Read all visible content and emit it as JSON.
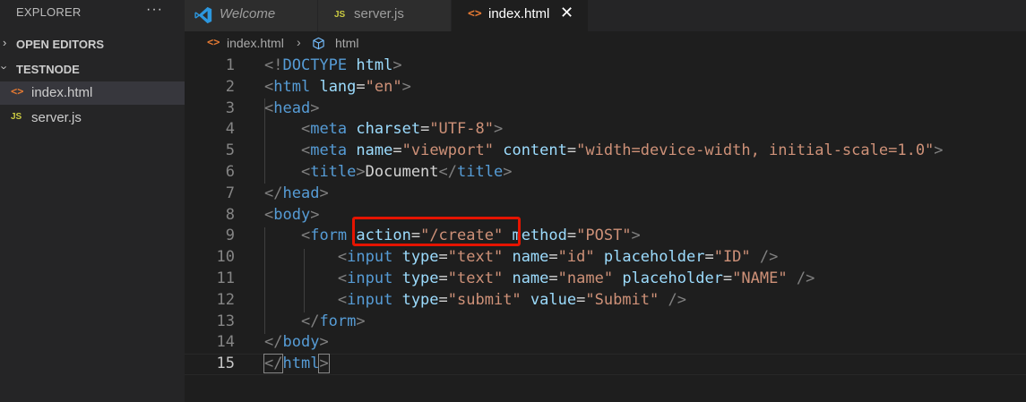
{
  "sidebar": {
    "title": "EXPLORER",
    "more": "···",
    "sections": [
      {
        "label": "OPEN EDITORS"
      },
      {
        "label": "TESTNODE"
      }
    ],
    "files": [
      {
        "name": "index.html",
        "icon": "<>",
        "type": "html"
      },
      {
        "name": "server.js",
        "icon": "JS",
        "type": "js"
      }
    ]
  },
  "tabs": [
    {
      "label": "Welcome"
    },
    {
      "label": "server.js",
      "icon": "JS"
    },
    {
      "label": "index.html",
      "icon": "<>",
      "close": "✕"
    }
  ],
  "breadcrumb": {
    "file": "index.html",
    "icon": "<>",
    "separator": "›",
    "element": "html"
  },
  "editor": {
    "active_line": 15,
    "lines": [
      {
        "n": "1",
        "tokens": [
          [
            "p",
            "<!"
          ],
          [
            "t",
            "DOCTYPE"
          ],
          [
            "x",
            " "
          ],
          [
            "a",
            "html"
          ],
          [
            "p",
            ">"
          ]
        ]
      },
      {
        "n": "2",
        "tokens": [
          [
            "p",
            "<"
          ],
          [
            "t",
            "html"
          ],
          [
            "x",
            " "
          ],
          [
            "a",
            "lang"
          ],
          [
            "x",
            "="
          ],
          [
            "s",
            "\"en\""
          ],
          [
            "p",
            ">"
          ]
        ]
      },
      {
        "n": "3",
        "tokens": [
          [
            "p",
            "<"
          ],
          [
            "t",
            "head"
          ],
          [
            "p",
            ">"
          ]
        ]
      },
      {
        "n": "4",
        "tokens": [
          [
            "x",
            "    "
          ],
          [
            "p",
            "<"
          ],
          [
            "t",
            "meta"
          ],
          [
            "x",
            " "
          ],
          [
            "a",
            "charset"
          ],
          [
            "x",
            "="
          ],
          [
            "s",
            "\"UTF-8\""
          ],
          [
            "p",
            ">"
          ]
        ]
      },
      {
        "n": "5",
        "tokens": [
          [
            "x",
            "    "
          ],
          [
            "p",
            "<"
          ],
          [
            "t",
            "meta"
          ],
          [
            "x",
            " "
          ],
          [
            "a",
            "name"
          ],
          [
            "x",
            "="
          ],
          [
            "s",
            "\"viewport\""
          ],
          [
            "x",
            " "
          ],
          [
            "a",
            "content"
          ],
          [
            "x",
            "="
          ],
          [
            "s",
            "\"width=device-width, initial-scale=1.0\""
          ],
          [
            "p",
            ">"
          ]
        ]
      },
      {
        "n": "6",
        "tokens": [
          [
            "x",
            "    "
          ],
          [
            "p",
            "<"
          ],
          [
            "t",
            "title"
          ],
          [
            "p",
            ">"
          ],
          [
            "x",
            "Document"
          ],
          [
            "p",
            "</"
          ],
          [
            "t",
            "title"
          ],
          [
            "p",
            ">"
          ]
        ]
      },
      {
        "n": "7",
        "tokens": [
          [
            "p",
            "</"
          ],
          [
            "t",
            "head"
          ],
          [
            "p",
            ">"
          ]
        ]
      },
      {
        "n": "8",
        "tokens": [
          [
            "p",
            "<"
          ],
          [
            "t",
            "body"
          ],
          [
            "p",
            ">"
          ]
        ]
      },
      {
        "n": "9",
        "tokens": [
          [
            "x",
            "    "
          ],
          [
            "p",
            "<"
          ],
          [
            "t",
            "form"
          ],
          [
            "x",
            " "
          ],
          [
            "a",
            "action"
          ],
          [
            "x",
            "="
          ],
          [
            "s",
            "\"/create\""
          ],
          [
            "x",
            " "
          ],
          [
            "a",
            "method"
          ],
          [
            "x",
            "="
          ],
          [
            "s",
            "\"POST\""
          ],
          [
            "p",
            ">"
          ]
        ]
      },
      {
        "n": "10",
        "tokens": [
          [
            "x",
            "        "
          ],
          [
            "p",
            "<"
          ],
          [
            "t",
            "input"
          ],
          [
            "x",
            " "
          ],
          [
            "a",
            "type"
          ],
          [
            "x",
            "="
          ],
          [
            "s",
            "\"text\""
          ],
          [
            "x",
            " "
          ],
          [
            "a",
            "name"
          ],
          [
            "x",
            "="
          ],
          [
            "s",
            "\"id\""
          ],
          [
            "x",
            " "
          ],
          [
            "a",
            "placeholder"
          ],
          [
            "x",
            "="
          ],
          [
            "s",
            "\"ID\""
          ],
          [
            "x",
            " "
          ],
          [
            "p",
            "/>"
          ]
        ]
      },
      {
        "n": "11",
        "tokens": [
          [
            "x",
            "        "
          ],
          [
            "p",
            "<"
          ],
          [
            "t",
            "input"
          ],
          [
            "x",
            " "
          ],
          [
            "a",
            "type"
          ],
          [
            "x",
            "="
          ],
          [
            "s",
            "\"text\""
          ],
          [
            "x",
            " "
          ],
          [
            "a",
            "name"
          ],
          [
            "x",
            "="
          ],
          [
            "s",
            "\"name\""
          ],
          [
            "x",
            " "
          ],
          [
            "a",
            "placeholder"
          ],
          [
            "x",
            "="
          ],
          [
            "s",
            "\"NAME\""
          ],
          [
            "x",
            " "
          ],
          [
            "p",
            "/>"
          ]
        ]
      },
      {
        "n": "12",
        "tokens": [
          [
            "x",
            "        "
          ],
          [
            "p",
            "<"
          ],
          [
            "t",
            "input"
          ],
          [
            "x",
            " "
          ],
          [
            "a",
            "type"
          ],
          [
            "x",
            "="
          ],
          [
            "s",
            "\"submit\""
          ],
          [
            "x",
            " "
          ],
          [
            "a",
            "value"
          ],
          [
            "x",
            "="
          ],
          [
            "s",
            "\"Submit\""
          ],
          [
            "x",
            " "
          ],
          [
            "p",
            "/>"
          ]
        ]
      },
      {
        "n": "13",
        "tokens": [
          [
            "x",
            "    "
          ],
          [
            "p",
            "</"
          ],
          [
            "t",
            "form"
          ],
          [
            "p",
            ">"
          ]
        ]
      },
      {
        "n": "14",
        "tokens": [
          [
            "p",
            "</"
          ],
          [
            "t",
            "body"
          ],
          [
            "p",
            ">"
          ]
        ]
      },
      {
        "n": "15",
        "tokens": [
          [
            "p",
            "</"
          ],
          [
            "t",
            "html"
          ],
          [
            "p",
            ">"
          ]
        ]
      }
    ]
  },
  "colors": {
    "tag": "#569cd6",
    "attribute": "#9cdcfe",
    "string": "#ce9178",
    "punctuation": "#808080",
    "highlight": "#e51400"
  }
}
